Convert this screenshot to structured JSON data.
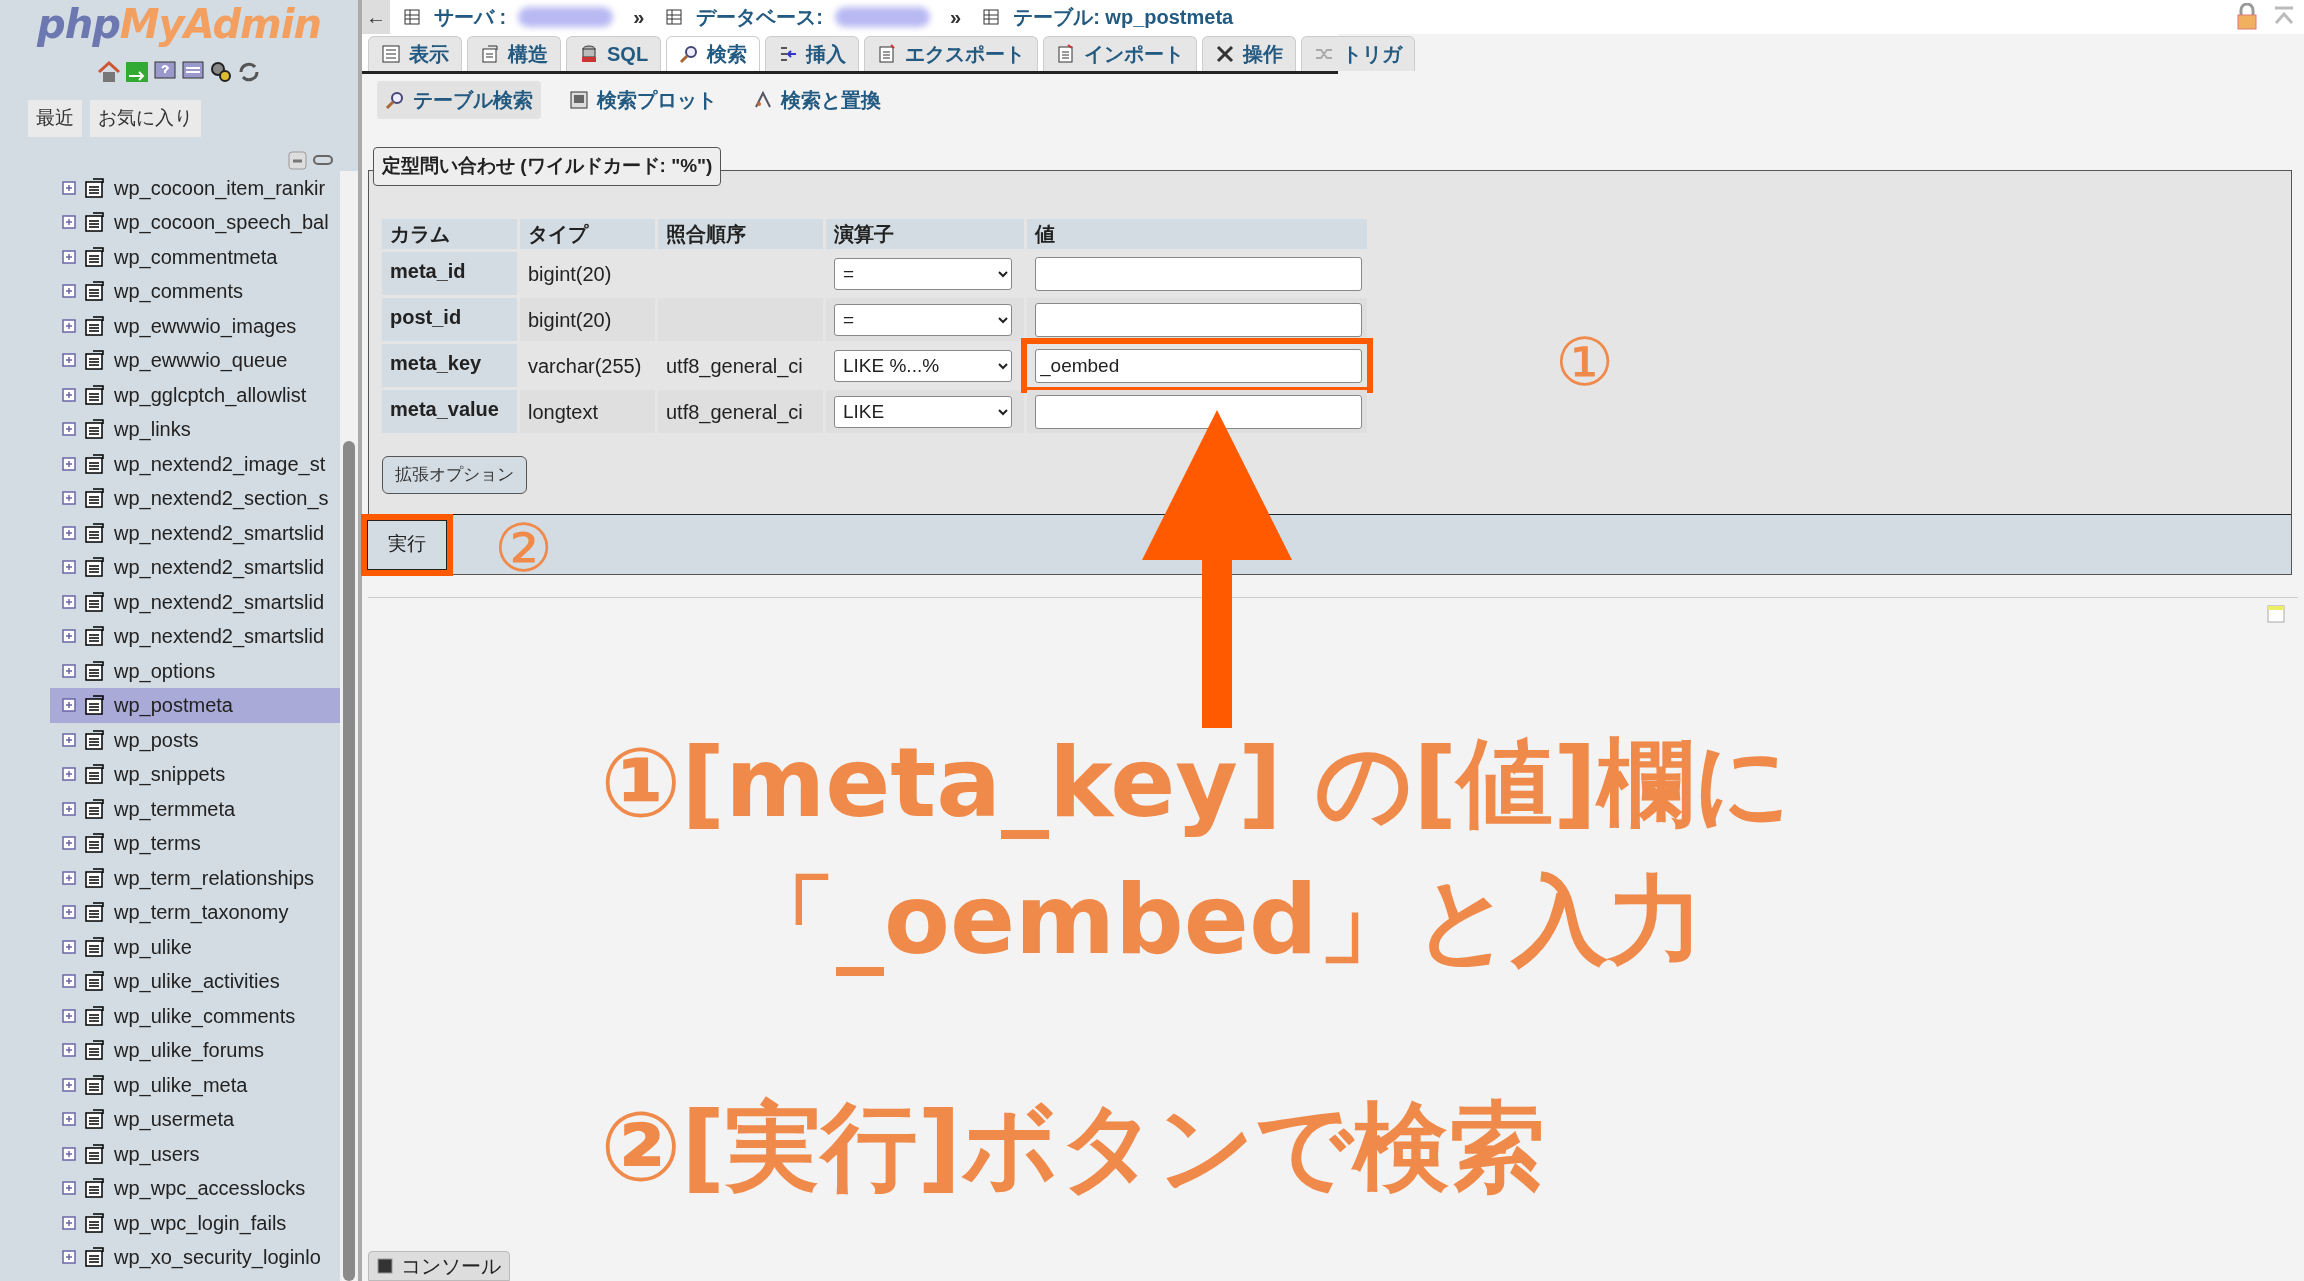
{
  "logo": {
    "php": "php",
    "myadmin": "MyAdmin"
  },
  "sidebar": {
    "tabs": [
      {
        "label": "最近"
      },
      {
        "label": "お気に入り"
      }
    ],
    "tables": [
      {
        "name": "wp_cocoon_item_rankir",
        "selected": false
      },
      {
        "name": "wp_cocoon_speech_bal",
        "selected": false
      },
      {
        "name": "wp_commentmeta",
        "selected": false
      },
      {
        "name": "wp_comments",
        "selected": false
      },
      {
        "name": "wp_ewwwio_images",
        "selected": false
      },
      {
        "name": "wp_ewwwio_queue",
        "selected": false
      },
      {
        "name": "wp_gglcptch_allowlist",
        "selected": false
      },
      {
        "name": "wp_links",
        "selected": false
      },
      {
        "name": "wp_nextend2_image_st",
        "selected": false
      },
      {
        "name": "wp_nextend2_section_s",
        "selected": false
      },
      {
        "name": "wp_nextend2_smartslid",
        "selected": false
      },
      {
        "name": "wp_nextend2_smartslid",
        "selected": false
      },
      {
        "name": "wp_nextend2_smartslid",
        "selected": false
      },
      {
        "name": "wp_nextend2_smartslid",
        "selected": false
      },
      {
        "name": "wp_options",
        "selected": false
      },
      {
        "name": "wp_postmeta",
        "selected": true
      },
      {
        "name": "wp_posts",
        "selected": false
      },
      {
        "name": "wp_snippets",
        "selected": false
      },
      {
        "name": "wp_termmeta",
        "selected": false
      },
      {
        "name": "wp_terms",
        "selected": false
      },
      {
        "name": "wp_term_relationships",
        "selected": false
      },
      {
        "name": "wp_term_taxonomy",
        "selected": false
      },
      {
        "name": "wp_ulike",
        "selected": false
      },
      {
        "name": "wp_ulike_activities",
        "selected": false
      },
      {
        "name": "wp_ulike_comments",
        "selected": false
      },
      {
        "name": "wp_ulike_forums",
        "selected": false
      },
      {
        "name": "wp_ulike_meta",
        "selected": false
      },
      {
        "name": "wp_usermeta",
        "selected": false
      },
      {
        "name": "wp_users",
        "selected": false
      },
      {
        "name": "wp_wpc_accesslocks",
        "selected": false
      },
      {
        "name": "wp_wpc_login_fails",
        "selected": false
      },
      {
        "name": "wp_xo_security_loginlo",
        "selected": false
      }
    ]
  },
  "breadcrumb": {
    "back": "←",
    "items": [
      {
        "label": "サーバ :",
        "redacted": true,
        "separator": "»"
      },
      {
        "label": "データベース:",
        "redacted": true,
        "separator": "»"
      },
      {
        "label": "テーブル: wp_postmeta",
        "redacted": false
      }
    ]
  },
  "tabs": [
    {
      "label": "表示",
      "selected": false
    },
    {
      "label": "構造",
      "selected": false
    },
    {
      "label": "SQL",
      "selected": false
    },
    {
      "label": "検索",
      "selected": true
    },
    {
      "label": "挿入",
      "selected": false
    },
    {
      "label": "エクスポート",
      "selected": false
    },
    {
      "label": "インポート",
      "selected": false
    },
    {
      "label": "操作",
      "selected": false
    },
    {
      "label": "トリガ",
      "selected": false
    }
  ],
  "subtabs": [
    {
      "label": "テーブル検索",
      "selected": true
    },
    {
      "label": "検索プロット",
      "selected": false
    },
    {
      "label": "検索と置換",
      "selected": false
    }
  ],
  "search_form": {
    "legend": "定型問い合わせ (ワイルドカード: \"%\")",
    "columns": [
      "カラム",
      "タイプ",
      "照合順序",
      "演算子",
      "値"
    ],
    "rows": [
      {
        "column": "meta_id",
        "type": "bigint(20)",
        "operator": "=",
        "highlighted": false
      },
      {
        "column": "post_id",
        "type": "bigint(20)",
        "operator": "=",
        "highlighted": false
      },
      {
        "column": "meta_key",
        "type": "varchar(255)",
        "collation": "utf8_general_ci",
        "operator": "LIKE %...%",
        "value": "_oembed",
        "highlighted": true
      },
      {
        "column": "meta_value",
        "type": "longtext",
        "collation": "utf8_general_ci",
        "operator": "LIKE",
        "highlighted": false
      }
    ],
    "options_button": "拡張オプション",
    "go_button": {
      "label": "実行",
      "highlighted": true
    }
  },
  "console": "コンソール",
  "annotations": {
    "marker_1": "①",
    "marker_2": "②",
    "lines": [
      "①[meta_key] の[値]欄に",
      "「_oembed」と入力",
      "②[実行]ボタンで検索"
    ]
  }
}
